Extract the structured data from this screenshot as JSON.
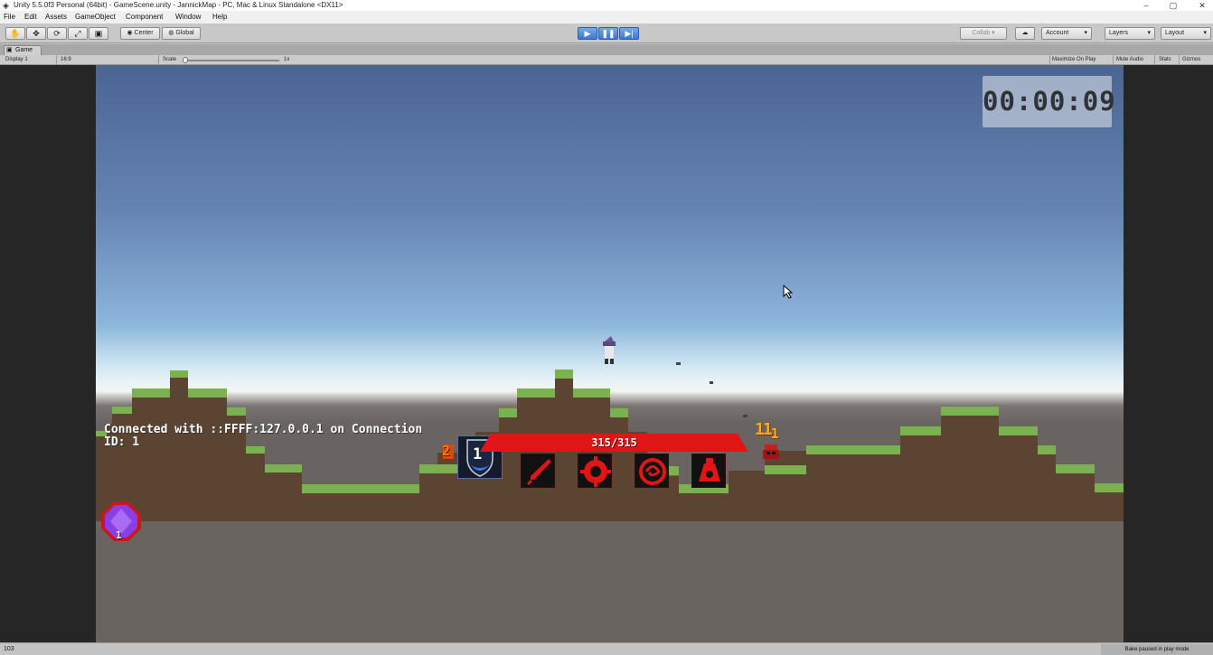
{
  "window": {
    "title": "Unity 5.5.0f3 Personal (64bit) - GameScene.unity - JannickMap - PC, Mac & Linux Standalone <DX11>",
    "minimize": "–",
    "maximize": "▢",
    "close": "✕"
  },
  "menu": [
    "File",
    "Edit",
    "Assets",
    "GameObject",
    "Component",
    "Window",
    "Help"
  ],
  "toolbar": {
    "tools": [
      "✋",
      "✥",
      "⟳",
      "⤢",
      "▣"
    ],
    "pivot_label": "Center",
    "space_label": "Global",
    "play": "▶",
    "pause": "❚❚",
    "step": "▶|",
    "collab_label": "Collab ▾",
    "cloud": "☁",
    "account_label": "Account",
    "layers_label": "Layers",
    "layout_label": "Layout"
  },
  "game_tab": {
    "tab_label": "Game",
    "display": "Display 1",
    "aspect": "16:9",
    "scale_label": "Scale",
    "scale_value": "1x",
    "scale_fraction": 0.0,
    "maximize_on_play": "Maximize On Play",
    "mute_audio": "Mute Audio",
    "stats": "Stats",
    "gizmos": "Gizmos"
  },
  "game": {
    "timer": "00:00:09",
    "connection_line1": "Connected with ::FFFF:127.0.0.1 on Connection",
    "connection_line2": "ID: 1",
    "hp": "315/315",
    "hp_fraction": 1.0,
    "player_level": "1",
    "ally_level": "2",
    "enemy_level": "11",
    "enemy_sub": "1",
    "gem_count": "1",
    "skills": [
      "dagger-skill",
      "gear-skill",
      "vortex-skill",
      "potion-skill"
    ],
    "colors": {
      "hp_bar": "#e01616",
      "skill_icon": "#e01616",
      "grass": "#78b04e",
      "dirt": "#5a4330",
      "gem": "#8a3fe6"
    }
  },
  "status": {
    "left": "103",
    "right": "Bake paused in play mode"
  }
}
